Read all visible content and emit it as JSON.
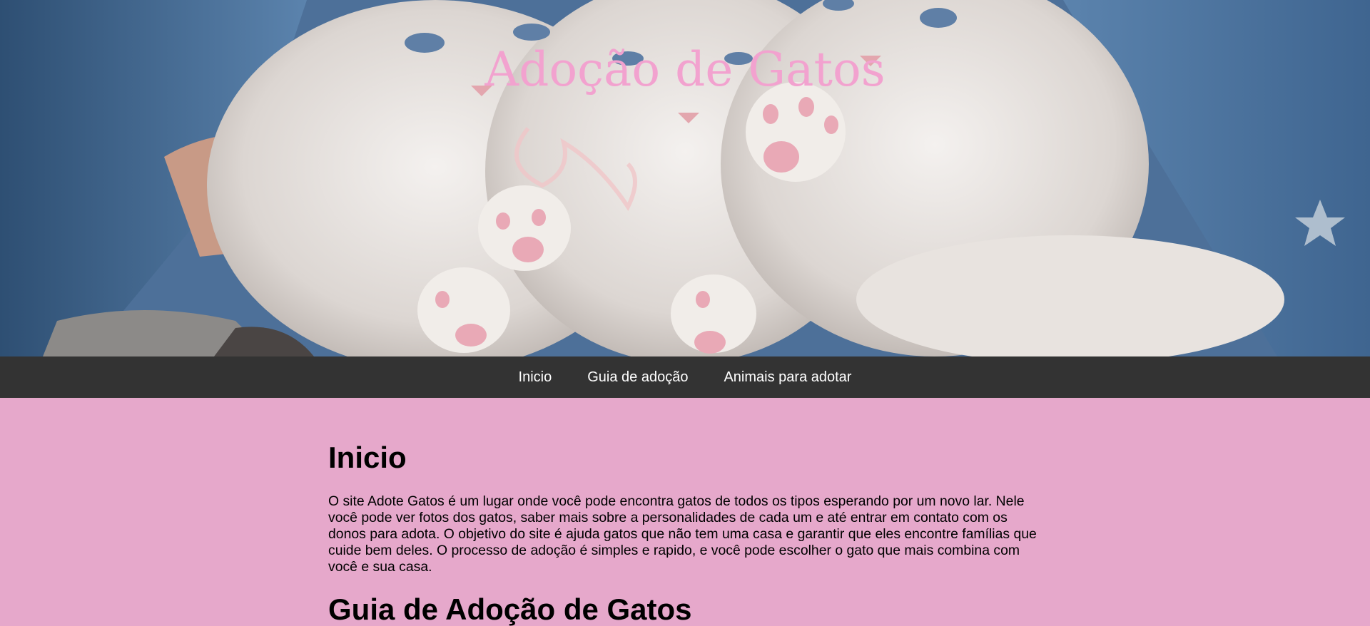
{
  "header": {
    "title": "Adoção de Gatos",
    "image_subject": "three-white-kittens-held-in-arms"
  },
  "nav": {
    "items": [
      {
        "label": "Inicio"
      },
      {
        "label": "Guia de adoção"
      },
      {
        "label": "Animais para adotar"
      }
    ]
  },
  "sections": {
    "inicio": {
      "heading": "Inicio",
      "body": "O site Adote Gatos é um lugar onde você pode encontra gatos de todos os tipos esperando por um novo lar. Nele você pode ver fotos dos gatos, saber mais sobre a personalidades de cada um e até entrar em contato com os donos para adota. O objetivo do site é ajuda gatos que não tem uma casa e garantir que eles encontre famílias que cuide bem deles. O processo de adoção é simples e rapido, e você pode escolher o gato que mais combina com você e sua casa."
    },
    "guia": {
      "heading": "Guia de Adoção de Gatos"
    }
  },
  "colors": {
    "title": "#f2a2cf",
    "nav_bg": "#333333",
    "page_bg": "#e6a8cb",
    "sleeve": "#4d7099"
  }
}
